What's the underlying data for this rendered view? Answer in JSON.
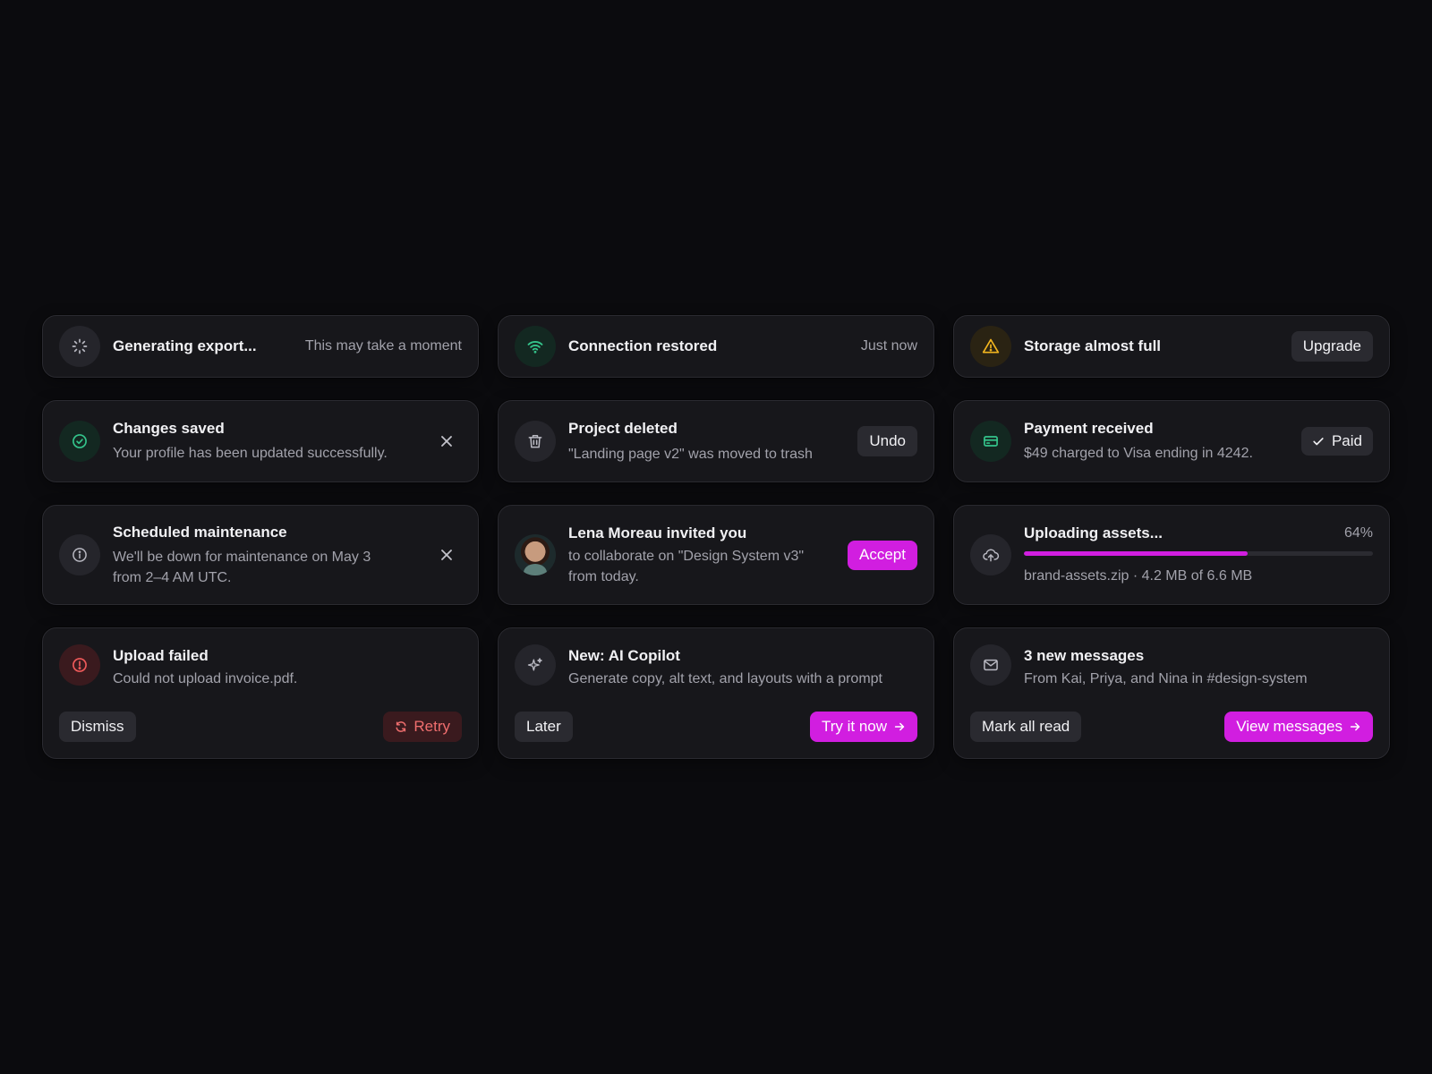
{
  "toasts": {
    "export": {
      "title": "Generating export...",
      "meta": "This may take a moment",
      "icon": "spinner-icon"
    },
    "connection": {
      "title": "Connection restored",
      "meta": "Just now",
      "icon": "wifi-icon",
      "color": "#34c48b"
    },
    "storage": {
      "title": "Storage almost full",
      "action": "Upgrade",
      "icon": "warning-icon",
      "color": "#f2b51f"
    },
    "saved": {
      "title": "Changes saved",
      "sub": "Your profile has been updated successfully.",
      "icon": "check-circle-icon",
      "color": "#34c48b"
    },
    "deleted": {
      "title": "Project deleted",
      "sub": "\"Landing page v2\" was moved to trash",
      "action": "Undo",
      "icon": "trash-icon"
    },
    "payment": {
      "title": "Payment received",
      "sub": "$49 charged to Visa ending in 4242.",
      "badge": "Paid",
      "icon": "credit-card-icon",
      "color": "#34c48b"
    },
    "maintenance": {
      "title": "Scheduled maintenance",
      "sub_line1": "We'll be down for maintenance on May 3",
      "sub_line2": "from 2–4 AM UTC.",
      "icon": "info-icon"
    },
    "invite": {
      "title": "Lena Moreau invited you",
      "sub_line1": "to collaborate on \"Design System v3\"",
      "sub_line2": "from today.",
      "action": "Accept"
    },
    "upload": {
      "title": "Uploading assets...",
      "percent_label": "64%",
      "progress": 0.64,
      "sub": "brand-assets.zip · 4.2 MB of 6.6 MB",
      "icon": "cloud-upload-icon"
    },
    "failed": {
      "title": "Upload failed",
      "sub": "Could not upload invoice.pdf.",
      "secondary": "Dismiss",
      "primary": "Retry",
      "icon": "alert-circle-icon",
      "color": "#ef5a5a"
    },
    "copilot": {
      "title": "New: AI Copilot",
      "sub": "Generate copy, alt text, and layouts with a prompt",
      "secondary": "Later",
      "primary": "Try it now",
      "icon": "sparkles-icon"
    },
    "messages": {
      "title": "3 new messages",
      "sub": "From Kai, Priya, and Nina in #design-system",
      "secondary": "Mark all read",
      "primary": "View messages",
      "icon": "mail-icon"
    }
  },
  "colors": {
    "accent": "#d11ee0",
    "success": "#34c48b",
    "warning": "#f2b51f",
    "danger": "#ef5a5a"
  }
}
